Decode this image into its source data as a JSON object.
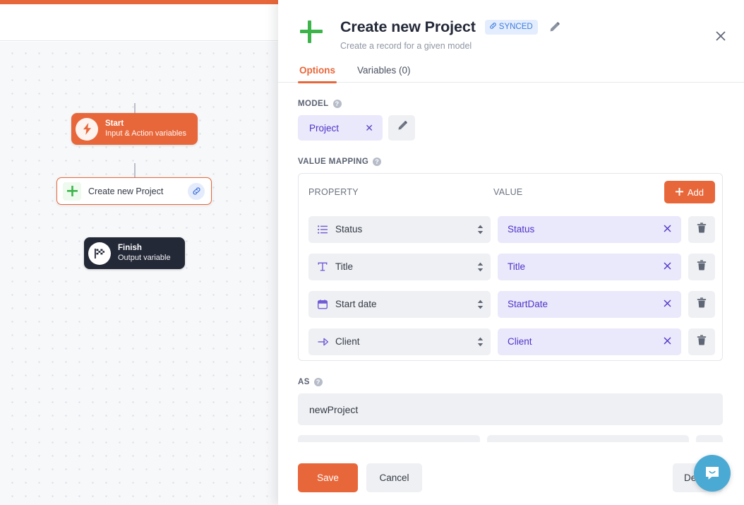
{
  "canvas": {
    "nodes": [
      {
        "id": "start",
        "title": "Start",
        "subtitle": "Input & Action variables",
        "icon": "lightning-icon"
      },
      {
        "id": "action",
        "title": "Create new Project",
        "subtitle": "",
        "icon": "plus-icon"
      },
      {
        "id": "finish",
        "title": "Finish",
        "subtitle": "Output variable",
        "icon": "checkered-flag-icon"
      }
    ]
  },
  "panel": {
    "title": "Create new Project",
    "subtitle": "Create a record for a given model",
    "badge": "SYNCED",
    "badge_icon": "link-icon",
    "edit_icon": "pencil-icon",
    "close_icon": "close-icon",
    "tabs": [
      {
        "label": "Options",
        "active": true
      },
      {
        "label": "Variables (0)",
        "active": false
      }
    ],
    "model": {
      "label": "MODEL",
      "chip": "Project",
      "chip_remove_icon": "close-icon",
      "edit_icon": "pencil-icon"
    },
    "value_mapping": {
      "label": "VALUE MAPPING",
      "columns": {
        "property": "PROPERTY",
        "value": "VALUE"
      },
      "add_label": "Add",
      "rows": [
        {
          "property": "Status",
          "property_icon": "list-icon",
          "value": "Status",
          "remove_icon": "close-icon",
          "delete_icon": "trash-icon"
        },
        {
          "property": "Title",
          "property_icon": "text-icon",
          "value": "Title",
          "remove_icon": "close-icon",
          "delete_icon": "trash-icon"
        },
        {
          "property": "Start date",
          "property_icon": "calendar-icon",
          "value": "StartDate",
          "remove_icon": "close-icon",
          "delete_icon": "trash-icon"
        },
        {
          "property": "Client",
          "property_icon": "relation-icon",
          "value": "Client",
          "remove_icon": "close-icon",
          "delete_icon": "trash-icon"
        }
      ]
    },
    "as_field": {
      "label": "AS",
      "value": "newProject"
    },
    "footer": {
      "save": "Save",
      "cancel": "Cancel",
      "delete": "Delete"
    }
  },
  "intercom": {
    "icon": "chat-smile-icon"
  },
  "colors": {
    "accent_orange": "#e8673a",
    "purple_chip_bg": "#eae8fb",
    "purple_text": "#4f35c9",
    "green_plus": "#3cb44a",
    "dark_node": "#242938",
    "synced_blue": "#3b7de0",
    "intercom_blue": "#4aaad4"
  }
}
